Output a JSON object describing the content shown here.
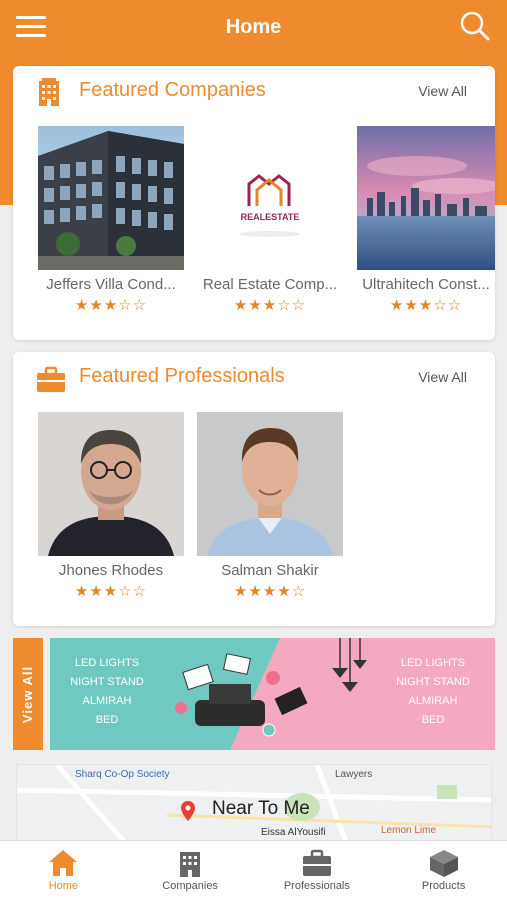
{
  "app_bar": {
    "title": "Home"
  },
  "companies": {
    "title": "Featured Companies",
    "view_all": "View All",
    "items": [
      {
        "name": "Jeffers Villa Cond...",
        "rating": "★★★☆☆"
      },
      {
        "name": "Real Estate Comp...",
        "rating": "★★★☆☆",
        "logo_text": "REALESTATE"
      },
      {
        "name": "Ultrahitech Const...",
        "rating": "★★★☆☆"
      }
    ]
  },
  "professionals": {
    "title": "Featured Professionals",
    "view_all": "View All",
    "items": [
      {
        "name": "Jhones Rhodes",
        "rating": "★★★☆☆"
      },
      {
        "name": "Salman Shakir",
        "rating": "★★★★☆"
      }
    ]
  },
  "banner": {
    "view_all": "View All",
    "left_lines": [
      "LED LIGHTS",
      "NIGHT STAND",
      "ALMIRAH",
      "BED"
    ],
    "right_lines": [
      "LED LIGHTS",
      "NIGHT STAND",
      "ALMIRAH",
      "BED"
    ]
  },
  "map": {
    "label": "Near To Me",
    "places": [
      "Sharq Co-Op Society",
      "Lawyers",
      "Eissa AlYousifi",
      "Lemon Lime"
    ]
  },
  "tabs": [
    {
      "label": "Home",
      "icon": "home-icon",
      "active": true
    },
    {
      "label": "Companies",
      "icon": "building-icon",
      "active": false
    },
    {
      "label": "Professionals",
      "icon": "briefcase-icon",
      "active": false
    },
    {
      "label": "Products",
      "icon": "box-icon",
      "active": false
    }
  ],
  "colors": {
    "accent": "#f08a2e",
    "background": "#eeeeee"
  }
}
